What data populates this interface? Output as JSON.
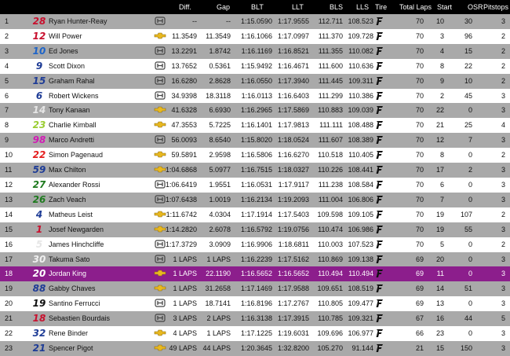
{
  "headers": [
    "Diff.",
    "Gap",
    "BLT",
    "LLT",
    "BLS",
    "LLS",
    "Tire",
    "Total Laps",
    "Start",
    "OSR",
    "Pitstops"
  ],
  "rows": [
    {
      "pos": "1",
      "car": "28",
      "driver": "Ryan Hunter-Reay",
      "engine": "honda",
      "diff": "--",
      "gap": "--",
      "blt": "1:15.0590",
      "llt": "1:17.9555",
      "bls": "112.711",
      "lls": "108.523",
      "laps": "70",
      "start": "10",
      "osr": "30",
      "pits": "3",
      "car_color": "#c8102e",
      "band": "odd"
    },
    {
      "pos": "2",
      "car": "12",
      "driver": "Will Power",
      "engine": "chevrolet",
      "diff": "11.3549",
      "gap": "11.3549",
      "blt": "1:16.1066",
      "llt": "1:17.0997",
      "bls": "111.370",
      "lls": "109.728",
      "laps": "70",
      "start": "3",
      "osr": "96",
      "pits": "2",
      "car_color": "#c8102e",
      "band": "even"
    },
    {
      "pos": "3",
      "car": "10",
      "driver": "Ed Jones",
      "engine": "honda",
      "diff": "13.2291",
      "gap": "1.8742",
      "blt": "1:16.1169",
      "llt": "1:16.8521",
      "bls": "111.355",
      "lls": "110.082",
      "laps": "70",
      "start": "4",
      "osr": "15",
      "pits": "2",
      "car_color": "#1e64c8",
      "band": "odd"
    },
    {
      "pos": "4",
      "car": "9",
      "driver": "Scott Dixon",
      "engine": "honda",
      "diff": "13.7652",
      "gap": "0.5361",
      "blt": "1:15.9492",
      "llt": "1:16.4671",
      "bls": "111.600",
      "lls": "110.636",
      "laps": "70",
      "start": "8",
      "osr": "22",
      "pits": "2",
      "car_color": "#1e3c96",
      "band": "even"
    },
    {
      "pos": "5",
      "car": "15",
      "driver": "Graham Rahal",
      "engine": "honda",
      "diff": "16.6280",
      "gap": "2.8628",
      "blt": "1:16.0550",
      "llt": "1:17.3940",
      "bls": "111.445",
      "lls": "109.311",
      "laps": "70",
      "start": "9",
      "osr": "10",
      "pits": "2",
      "car_color": "#1e3c96",
      "band": "odd"
    },
    {
      "pos": "6",
      "car": "6",
      "driver": "Robert Wickens",
      "engine": "honda",
      "diff": "34.9398",
      "gap": "18.3118",
      "blt": "1:16.0113",
      "llt": "1:16.6403",
      "bls": "111.299",
      "lls": "110.386",
      "laps": "70",
      "start": "2",
      "osr": "45",
      "pits": "3",
      "car_color": "#1e3c96",
      "band": "even"
    },
    {
      "pos": "7",
      "car": "14",
      "driver": "Tony Kanaan",
      "engine": "chevrolet",
      "diff": "41.6328",
      "gap": "6.6930",
      "blt": "1:16.2965",
      "llt": "1:17.5869",
      "bls": "110.883",
      "lls": "109.039",
      "laps": "70",
      "start": "22",
      "osr": "0",
      "pits": "3",
      "car_color": "#e6e6e6",
      "band": "odd"
    },
    {
      "pos": "8",
      "car": "23",
      "driver": "Charlie Kimball",
      "engine": "chevrolet",
      "diff": "47.3553",
      "gap": "5.7225",
      "blt": "1:16.1401",
      "llt": "1:17.9813",
      "bls": "111.111",
      "lls": "108.488",
      "laps": "70",
      "start": "21",
      "osr": "25",
      "pits": "4",
      "car_color": "#9acd32",
      "band": "even"
    },
    {
      "pos": "9",
      "car": "98",
      "driver": "Marco Andretti",
      "engine": "honda",
      "diff": "56.0093",
      "gap": "8.6540",
      "blt": "1:15.8020",
      "llt": "1:18.0524",
      "bls": "111.607",
      "lls": "108.389",
      "laps": "70",
      "start": "12",
      "osr": "7",
      "pits": "3",
      "car_color": "#d11bb5",
      "band": "odd"
    },
    {
      "pos": "10",
      "car": "22",
      "driver": "Simon Pagenaud",
      "engine": "chevrolet",
      "diff": "59.5891",
      "gap": "2.9598",
      "blt": "1:16.5806",
      "llt": "1:16.6270",
      "bls": "110.518",
      "lls": "110.405",
      "laps": "70",
      "start": "8",
      "osr": "0",
      "pits": "2",
      "car_color": "#e41e1e",
      "band": "even"
    },
    {
      "pos": "11",
      "car": "59",
      "driver": "Max Chilton",
      "engine": "chevrolet",
      "diff": "1:04.6868",
      "gap": "5.0977",
      "blt": "1:16.7515",
      "llt": "1:18.0327",
      "bls": "110.226",
      "lls": "108.441",
      "laps": "70",
      "start": "17",
      "osr": "2",
      "pits": "3",
      "car_color": "#1e3c96",
      "band": "odd"
    },
    {
      "pos": "12",
      "car": "27",
      "driver": "Alexander Rossi",
      "engine": "honda",
      "diff": "1:06.6419",
      "gap": "1.9551",
      "blt": "1:16.0531",
      "llt": "1:17.9117",
      "bls": "111.238",
      "lls": "108.584",
      "laps": "70",
      "start": "6",
      "osr": "0",
      "pits": "3",
      "car_color": "#1e7a1e",
      "band": "even"
    },
    {
      "pos": "13",
      "car": "26",
      "driver": "Zach Veach",
      "engine": "honda",
      "diff": "1:07.6438",
      "gap": "1.0019",
      "blt": "1:16.2134",
      "llt": "1:19.2093",
      "bls": "111.004",
      "lls": "106.806",
      "laps": "70",
      "start": "7",
      "osr": "0",
      "pits": "3",
      "car_color": "#1e7a1e",
      "band": "odd"
    },
    {
      "pos": "14",
      "car": "4",
      "driver": "Matheus Leist",
      "engine": "chevrolet",
      "diff": "1:11.6742",
      "gap": "4.0304",
      "blt": "1:17.1914",
      "llt": "1:17.5403",
      "bls": "109.598",
      "lls": "109.105",
      "laps": "70",
      "start": "19",
      "osr": "107",
      "pits": "2",
      "car_color": "#1e3c96",
      "band": "even"
    },
    {
      "pos": "15",
      "car": "1",
      "driver": "Josef Newgarden",
      "engine": "chevrolet",
      "diff": "1:14.2820",
      "gap": "2.6078",
      "blt": "1:16.5792",
      "llt": "1:19.0756",
      "bls": "110.474",
      "lls": "106.986",
      "laps": "70",
      "start": "19",
      "osr": "55",
      "pits": "3",
      "car_color": "#c8102e",
      "band": "odd"
    },
    {
      "pos": "16",
      "car": "5",
      "driver": "James Hinchcliffe",
      "engine": "honda",
      "diff": "1:17.3729",
      "gap": "3.0909",
      "blt": "1:16.9906",
      "llt": "1:18.6811",
      "bls": "110.003",
      "lls": "107.523",
      "laps": "70",
      "start": "5",
      "osr": "0",
      "pits": "2",
      "car_color": "#e6e6e6",
      "band": "even"
    },
    {
      "pos": "17",
      "car": "30",
      "driver": "Takuma Sato",
      "engine": "honda",
      "diff": "1 LAPS",
      "gap": "1 LAPS",
      "blt": "1:16.2239",
      "llt": "1:17.5162",
      "bls": "110.869",
      "lls": "109.138",
      "laps": "69",
      "start": "20",
      "osr": "0",
      "pits": "3",
      "car_color": "#f0f0f0",
      "band": "odd"
    },
    {
      "pos": "18",
      "car": "20",
      "driver": "Jordan King",
      "engine": "chevrolet",
      "diff": "1 LAPS",
      "gap": "22.1190",
      "blt": "1:16.5652",
      "llt": "1:16.5652",
      "bls": "110.494",
      "lls": "110.494",
      "laps": "69",
      "start": "11",
      "osr": "0",
      "pits": "3",
      "car_color": "#ffffff",
      "band": "hl"
    },
    {
      "pos": "19",
      "car": "88",
      "driver": "Gabby Chaves",
      "engine": "chevrolet",
      "diff": "1 LAPS",
      "gap": "31.2658",
      "blt": "1:17.1469",
      "llt": "1:17.9588",
      "bls": "109.651",
      "lls": "108.519",
      "laps": "69",
      "start": "14",
      "osr": "51",
      "pits": "3",
      "car_color": "#1e3c96",
      "band": "odd"
    },
    {
      "pos": "20",
      "car": "19",
      "driver": "Santino Ferrucci",
      "engine": "honda",
      "diff": "1 LAPS",
      "gap": "18.7141",
      "blt": "1:16.8196",
      "llt": "1:17.2767",
      "bls": "110.805",
      "lls": "109.477",
      "laps": "69",
      "start": "13",
      "osr": "0",
      "pits": "3",
      "car_color": "#111111",
      "band": "even"
    },
    {
      "pos": "21",
      "car": "18",
      "driver": "Sebastien Bourdais",
      "engine": "honda",
      "diff": "3 LAPS",
      "gap": "2 LAPS",
      "blt": "1:16.3138",
      "llt": "1:17.3915",
      "bls": "110.785",
      "lls": "109.321",
      "laps": "67",
      "start": "16",
      "osr": "44",
      "pits": "5",
      "car_color": "#c8102e",
      "band": "odd"
    },
    {
      "pos": "22",
      "car": "32",
      "driver": "Rene Binder",
      "engine": "chevrolet",
      "diff": "4 LAPS",
      "gap": "1 LAPS",
      "blt": "1:17.1225",
      "llt": "1:19.6031",
      "bls": "109.696",
      "lls": "106.977",
      "laps": "66",
      "start": "23",
      "osr": "0",
      "pits": "3",
      "car_color": "#1e3c96",
      "band": "even"
    },
    {
      "pos": "23",
      "car": "21",
      "driver": "Spencer Pigot",
      "engine": "chevrolet",
      "diff": "49 LAPS",
      "gap": "44 LAPS",
      "blt": "1:20.3645",
      "llt": "1:32.8200",
      "bls": "105.270",
      "lls": "91.144",
      "laps": "21",
      "start": "15",
      "osr": "150",
      "pits": "3",
      "car_color": "#1e3c96",
      "band": "odd"
    }
  ]
}
